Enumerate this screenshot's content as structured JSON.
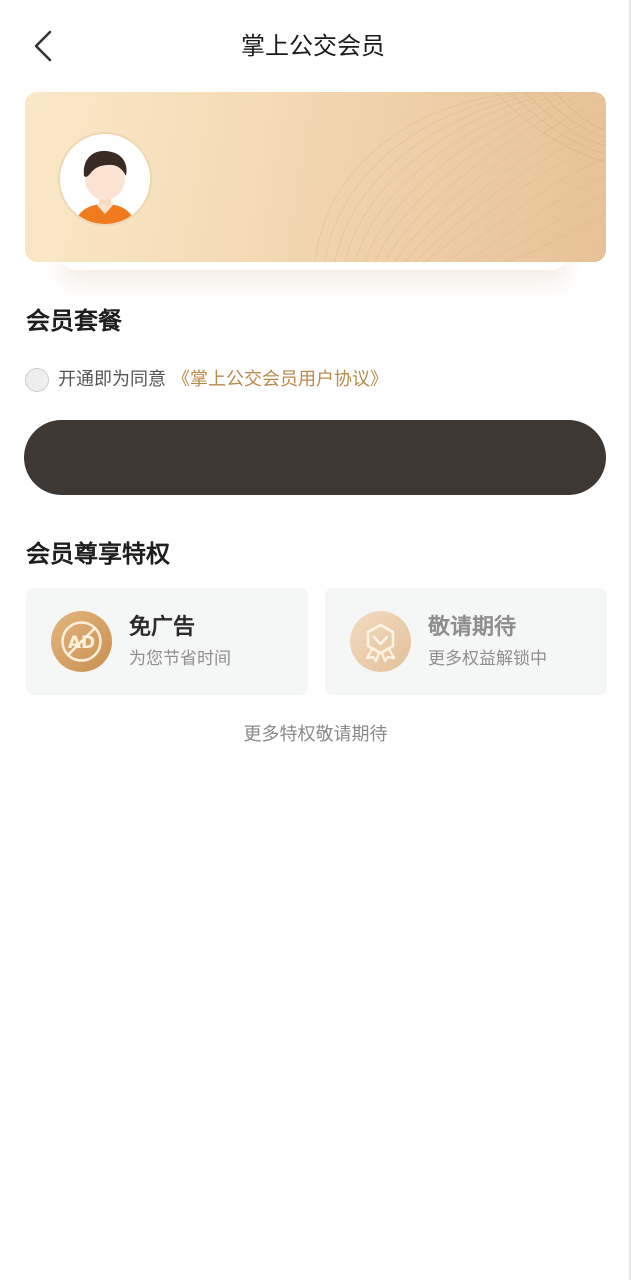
{
  "header": {
    "title": "掌上公交会员",
    "back_icon": "chevron-left-icon"
  },
  "member_card": {
    "avatar_icon": "user-avatar-icon"
  },
  "plans": {
    "section_title": "会员套餐",
    "agreement": {
      "text": "开通即为同意",
      "link": "《掌上公交会员用户协议》",
      "checked": false
    },
    "open_button_label": ""
  },
  "privileges": {
    "section_title": "会员尊享特权",
    "items": [
      {
        "title": "免广告",
        "subtitle": "为您节省时间",
        "icon": "no-ad-icon"
      },
      {
        "title": "敬请期待",
        "subtitle": "更多权益解锁中",
        "icon": "badge-icon"
      }
    ],
    "more_note": "更多特权敬请期待"
  },
  "colors": {
    "accent_gold": "#b78a4a",
    "button_dark": "#3d3834",
    "card_bg": "#f5f6f6"
  }
}
